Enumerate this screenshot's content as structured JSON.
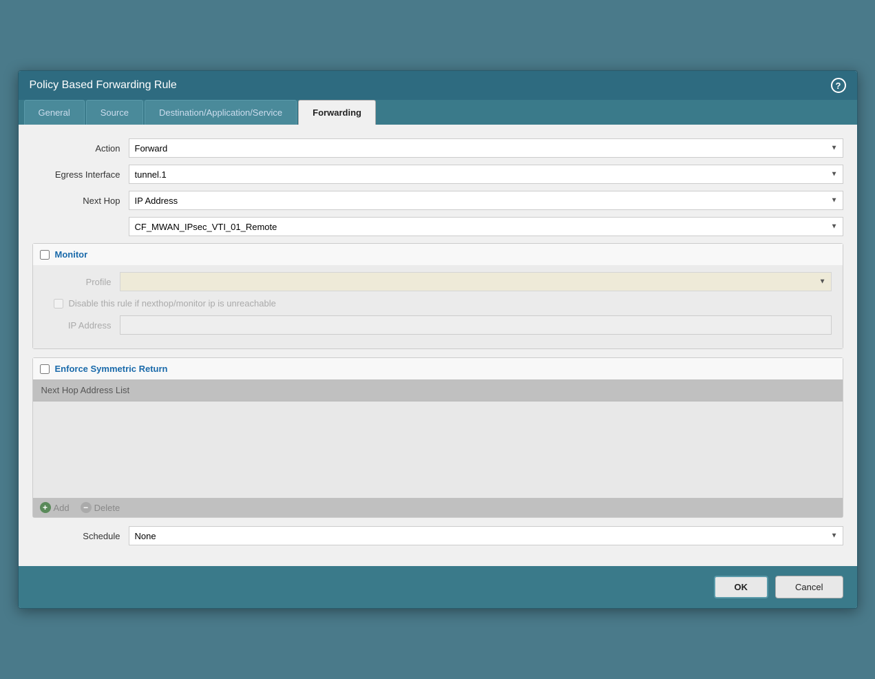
{
  "dialog": {
    "title": "Policy Based Forwarding Rule",
    "help_icon": "?",
    "tabs": [
      {
        "id": "general",
        "label": "General",
        "active": false
      },
      {
        "id": "source",
        "label": "Source",
        "active": false
      },
      {
        "id": "destination",
        "label": "Destination/Application/Service",
        "active": false
      },
      {
        "id": "forwarding",
        "label": "Forwarding",
        "active": true
      }
    ]
  },
  "form": {
    "action_label": "Action",
    "action_value": "Forward",
    "egress_label": "Egress Interface",
    "egress_value": "tunnel.1",
    "nexthop_label": "Next Hop",
    "nexthop_value": "IP Address",
    "nexthop_sub_value": "CF_MWAN_IPsec_VTI_01_Remote",
    "monitor_section_label": "Monitor",
    "monitor_checked": false,
    "profile_label": "Profile",
    "profile_value": "",
    "disable_checkbox_label": "Disable this rule if nexthop/monitor ip is unreachable",
    "disable_checked": false,
    "ip_address_label": "IP Address",
    "ip_address_value": "",
    "enforce_section_label": "Enforce Symmetric Return",
    "enforce_checked": false,
    "nexthop_list_header": "Next Hop Address List",
    "add_label": "Add",
    "delete_label": "Delete",
    "schedule_label": "Schedule",
    "schedule_value": "None"
  },
  "footer": {
    "ok_label": "OK",
    "cancel_label": "Cancel"
  }
}
